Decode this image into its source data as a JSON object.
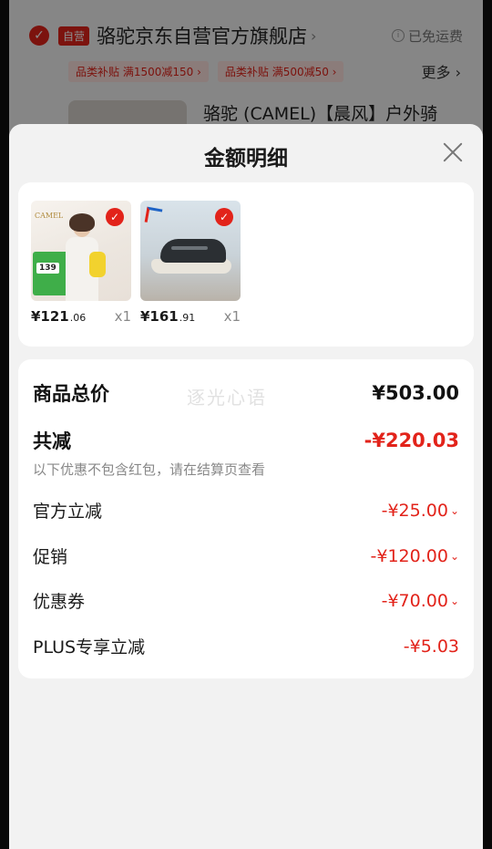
{
  "background": {
    "self_badge": "自营",
    "shop_name": "骆驼京东自营官方旗舰店",
    "shop_arrow": "›",
    "free_shipping": "已免运费",
    "promo_tags": [
      "品类补贴 满1500减150 ›",
      "品类补贴 满500减50 ›"
    ],
    "more": "更多 ›",
    "product_title": "骆驼 (CAMEL)【晨风】户外骑"
  },
  "sheet": {
    "title": "金额明细",
    "watermark": "逐光心语"
  },
  "products": [
    {
      "price_int": "¥121",
      "price_dec": ".06",
      "qty": "x1",
      "brand": "CAMEL",
      "chip": "139"
    },
    {
      "price_int": "¥161",
      "price_dec": ".91",
      "qty": "x1"
    }
  ],
  "details": {
    "total_label": "商品总价",
    "total_value": "¥503.00",
    "reduce_label": "共减",
    "reduce_value": "-¥220.03",
    "note": "以下优惠不包含红包，请在结算页查看",
    "official_label": "官方立减",
    "official_value": "-¥25.00",
    "promo_label": "促销",
    "promo_value": "-¥120.00",
    "coupon_label": "优惠券",
    "coupon_value": "-¥70.00",
    "plus_label": "PLUS专享立减",
    "plus_value": "-¥5.03",
    "chevron": "⌄"
  },
  "colors": {
    "accent": "#e2231a",
    "sheet_bg": "#f2f2f2"
  }
}
